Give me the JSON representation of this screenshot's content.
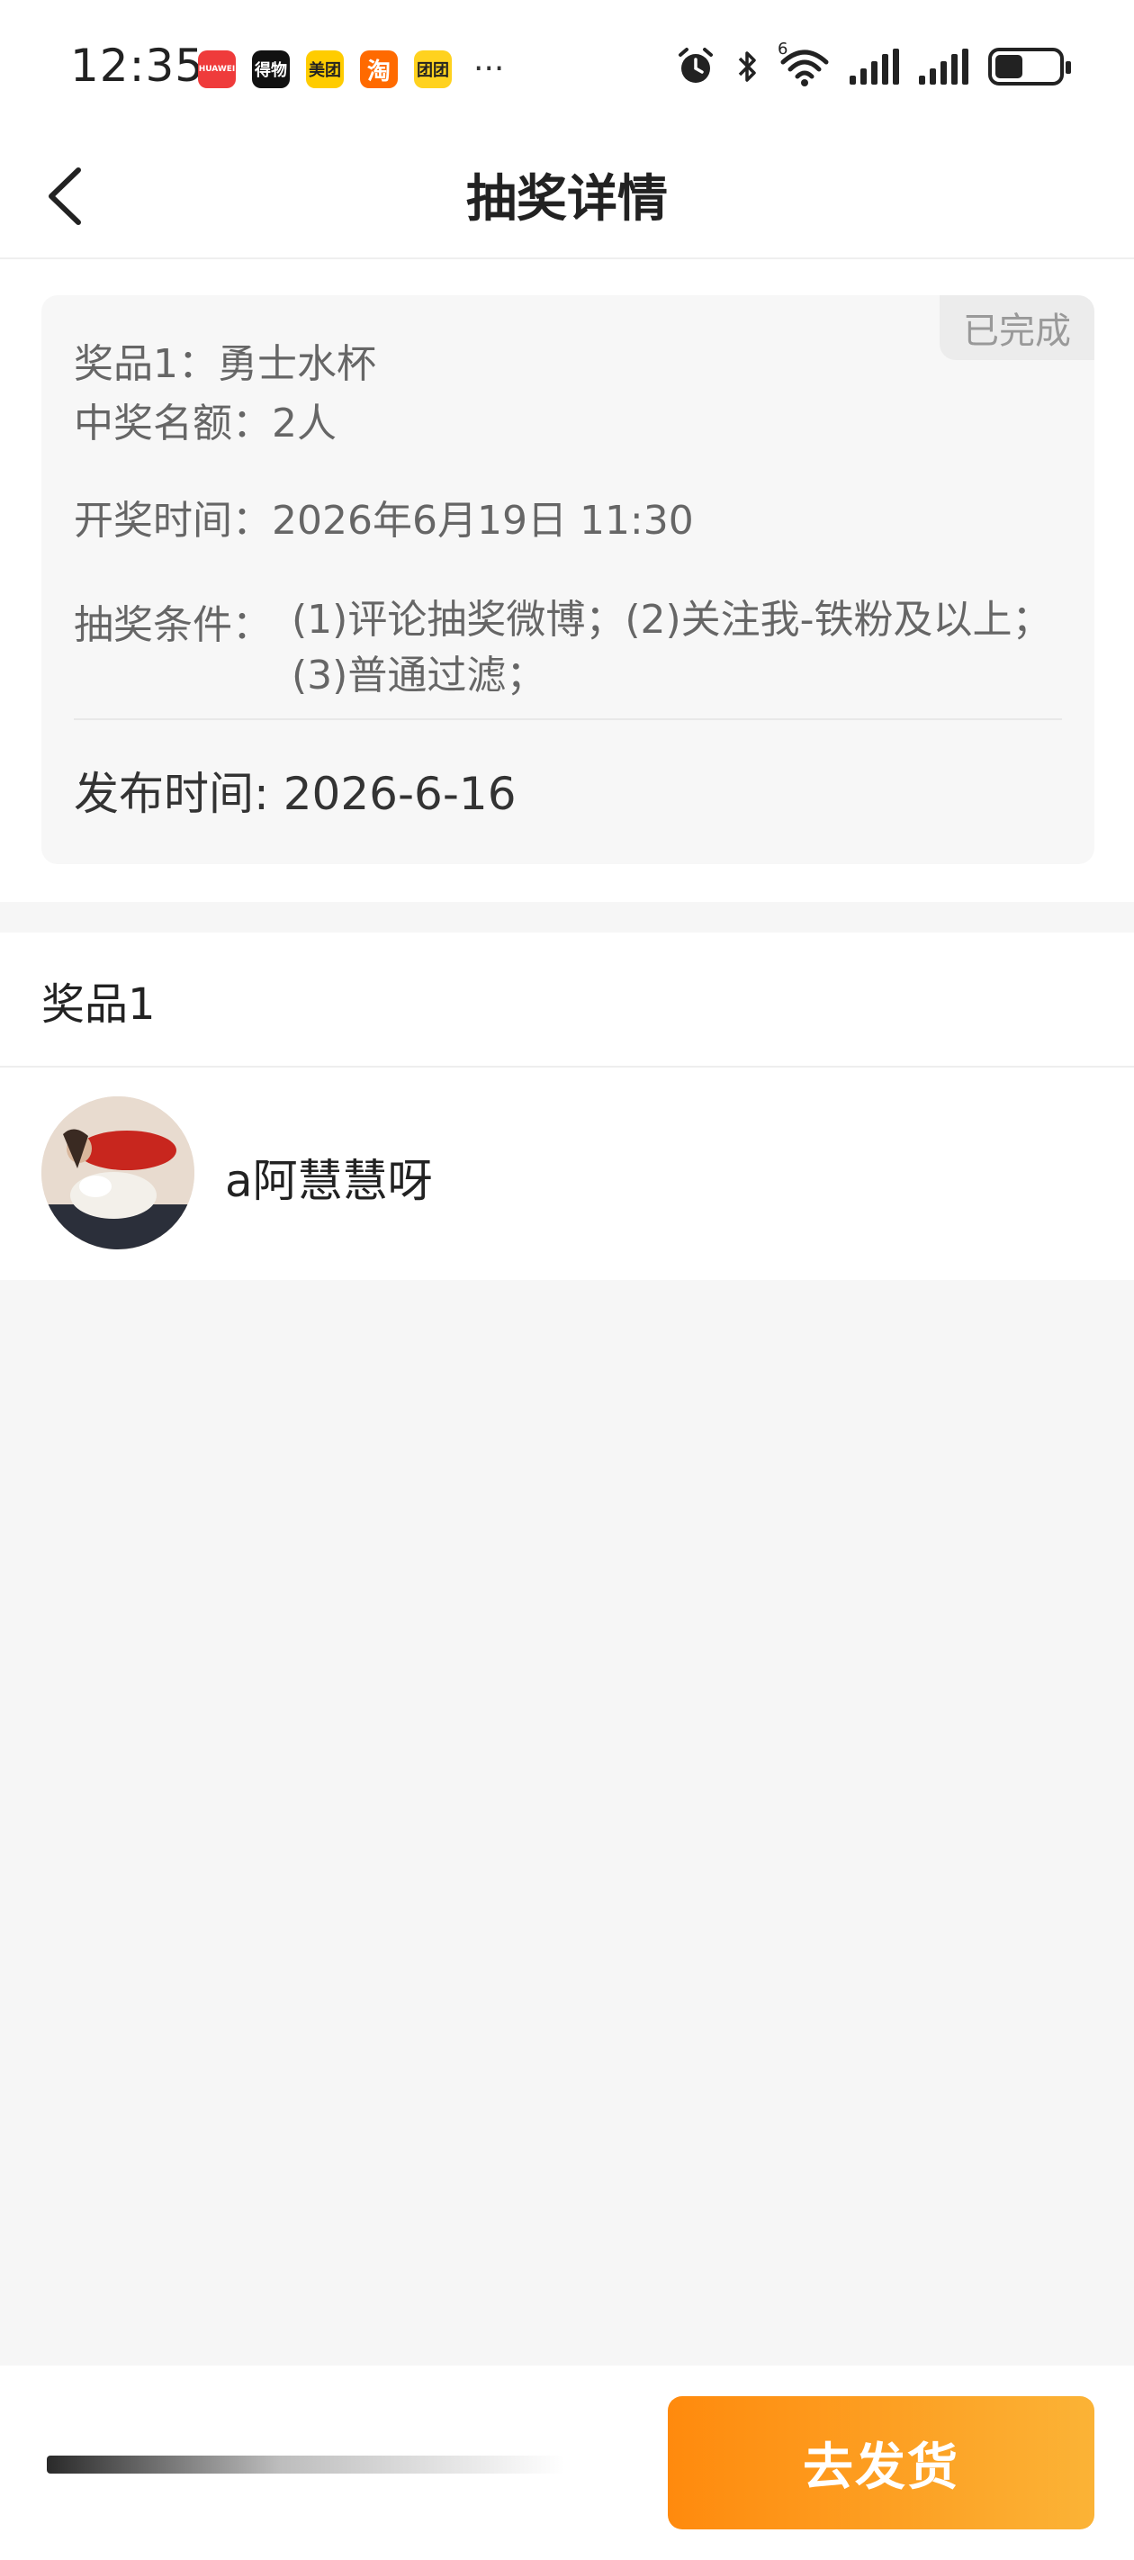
{
  "status_bar": {
    "time": "12:35",
    "apps": [
      {
        "name": "huawei-app-icon",
        "label": "HUAWEI",
        "color": "#ef3b3b"
      },
      {
        "name": "dewu-app-icon",
        "label": "得物",
        "color": "#111111"
      },
      {
        "name": "meituan-app-icon",
        "label": "美团",
        "color": "#ffcc00"
      },
      {
        "name": "taobao-app-icon",
        "label": "淘",
        "color": "#ff6a00"
      },
      {
        "name": "tuanyou-app-icon",
        "label": "团团",
        "color": "#ffd21f"
      }
    ],
    "more": "···",
    "network_gen": "6"
  },
  "nav": {
    "title": "抽奖详情"
  },
  "lottery_card": {
    "status_tag": "已完成",
    "prize_line": "奖品1：勇士水杯",
    "quota_line": "中奖名额：2人",
    "draw_time_line": "开奖时间：2026年6月19日 11:30",
    "conditions_label": "抽奖条件：",
    "conditions_value": "(1)评论抽奖微博；(2)关注我-铁粉及以上；(3)普通过滤；",
    "publish_line": "发布时间: 2026-6-16"
  },
  "prize_section": {
    "heading": "奖品1",
    "winners": [
      {
        "name": "a阿慧慧呀"
      }
    ]
  },
  "bottom_bar": {
    "ship_button": "去发货"
  },
  "colors": {
    "accent_start": "#ff8a0d",
    "accent_end": "#fbb336"
  }
}
